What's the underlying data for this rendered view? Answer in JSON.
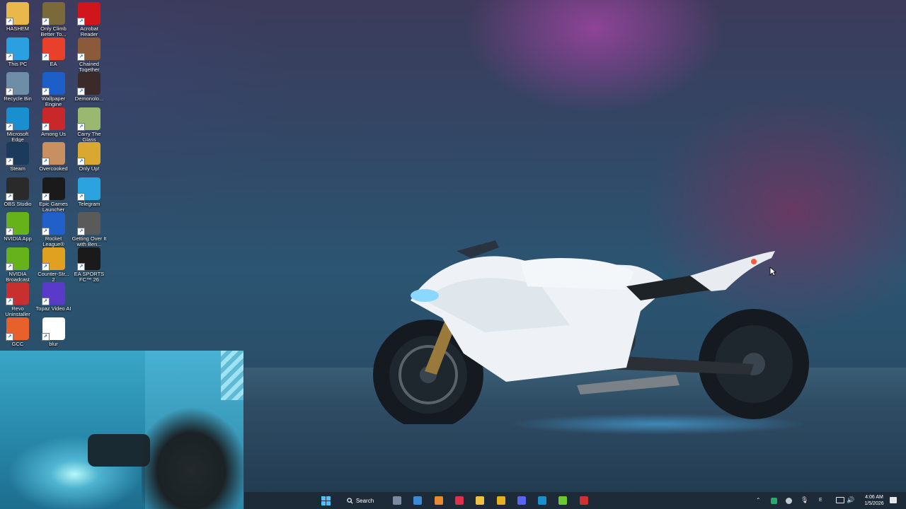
{
  "desktop_icons": [
    {
      "label": "HASHEM",
      "icon": "folder-icon",
      "color": "#e8b84a"
    },
    {
      "label": "Only Climb Better To...",
      "icon": "game-only-climb-icon",
      "color": "#7a6a3a"
    },
    {
      "label": "Acrobat Reader",
      "icon": "acrobat-reader-icon",
      "color": "#d0161b"
    },
    {
      "label": "This PC",
      "icon": "this-pc-icon",
      "color": "#2aa0e0"
    },
    {
      "label": "EA",
      "icon": "ea-icon",
      "color": "#e8402a"
    },
    {
      "label": "Chained Together",
      "icon": "chained-together-icon",
      "color": "#8a5a3a"
    },
    {
      "label": "Recycle Bin",
      "icon": "recycle-bin-icon",
      "color": "#6e8ea8"
    },
    {
      "label": "Wallpaper Engine",
      "icon": "wallpaper-engine-icon",
      "color": "#1d5fc6"
    },
    {
      "label": "Demonolo...",
      "icon": "demonologist-icon",
      "color": "#3a2a2a"
    },
    {
      "label": "Microsoft Edge",
      "icon": "edge-icon",
      "color": "#1a8fd0"
    },
    {
      "label": "Among Us",
      "icon": "among-us-icon",
      "color": "#c8282a"
    },
    {
      "label": "Carry The Glass",
      "icon": "carry-the-glass-icon",
      "color": "#9ab870"
    },
    {
      "label": "Steam",
      "icon": "steam-icon",
      "color": "#1b3a5c"
    },
    {
      "label": "Overcooked",
      "icon": "overcooked-icon",
      "color": "#c89060"
    },
    {
      "label": "Only Up!",
      "icon": "only-up-icon",
      "color": "#d8a830"
    },
    {
      "label": "OBS Studio",
      "icon": "obs-studio-icon",
      "color": "#2a2a2a"
    },
    {
      "label": "Epic Games Launcher",
      "icon": "epic-games-icon",
      "color": "#1a1a1a"
    },
    {
      "label": "Telegram",
      "icon": "telegram-icon",
      "color": "#2aa3de"
    },
    {
      "label": "NVIDIA App",
      "icon": "nvidia-app-icon",
      "color": "#66b21a"
    },
    {
      "label": "Rocket League®",
      "icon": "rocket-league-icon",
      "color": "#2060c8"
    },
    {
      "label": "Getting Over It with Ben...",
      "icon": "getting-over-it-icon",
      "color": "#5a5a5a"
    },
    {
      "label": "NVIDIA Broadcast",
      "icon": "nvidia-broadcast-icon",
      "color": "#66b21a"
    },
    {
      "label": "Counter-Str... 2",
      "icon": "counter-strike-icon",
      "color": "#e0a020"
    },
    {
      "label": "EA SPORTS FC™ 26",
      "icon": "ea-sports-fc-icon",
      "color": "#1a1a1a"
    },
    {
      "label": "Revo Uninstaller",
      "icon": "revo-uninstaller-icon",
      "color": "#c83030"
    },
    {
      "label": "Topaz Video AI",
      "icon": "topaz-video-ai-icon",
      "color": "#5a3ac8"
    },
    {
      "label": "",
      "icon": "blank-slot",
      "color": "transparent"
    },
    {
      "label": "GCC",
      "icon": "gcc-icon",
      "color": "#e8602a"
    },
    {
      "label": "blur",
      "icon": "blur-file-icon",
      "color": "#ffffff"
    }
  ],
  "taskbar": {
    "search_label": "Search",
    "apps": [
      {
        "icon": "settings-icon",
        "color": "#7a8aa0"
      },
      {
        "icon": "photos-icon",
        "color": "#3a8ad8"
      },
      {
        "icon": "cloud-app-icon",
        "color": "#e88a30"
      },
      {
        "icon": "red-app-icon",
        "color": "#e0304a"
      },
      {
        "icon": "file-explorer-icon",
        "color": "#f0c040"
      },
      {
        "icon": "chrome-icon",
        "color": "#e8b020"
      },
      {
        "icon": "discord-icon",
        "color": "#5865f2"
      },
      {
        "icon": "edge-icon",
        "color": "#1a8fd0"
      },
      {
        "icon": "green-play-icon",
        "color": "#6ac830"
      },
      {
        "icon": "red-circle-app-icon",
        "color": "#d03030"
      }
    ],
    "tray": {
      "lang_label": "E",
      "time": "4:06 AM",
      "date": "1/5/2026"
    }
  }
}
